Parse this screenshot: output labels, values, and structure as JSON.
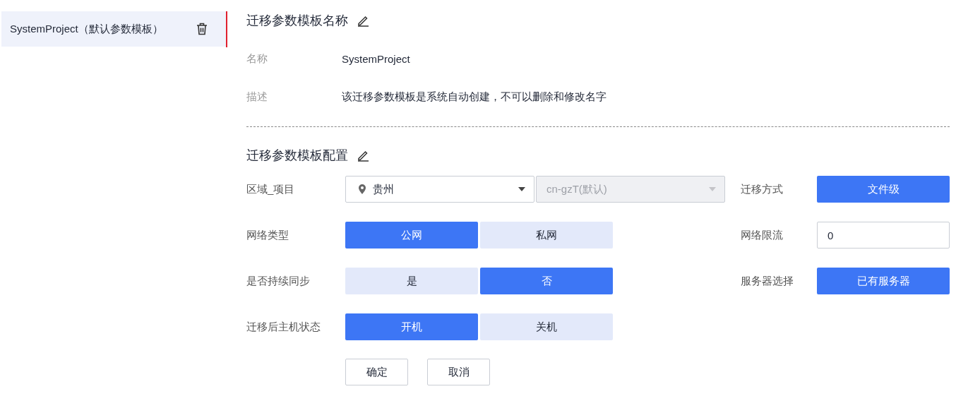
{
  "sidebar": {
    "items": [
      {
        "label": "SystemProject（默认参数模板）",
        "selected": true
      }
    ]
  },
  "name_section": {
    "title": "迁移参数模板名称",
    "fields": [
      {
        "label": "名称",
        "value": "SystemProject"
      },
      {
        "label": "描述",
        "value": "该迁移参数模板是系统自动创建，不可以删除和修改名字"
      }
    ]
  },
  "config_section": {
    "title": "迁移参数模板配置",
    "left_rows": [
      {
        "kind": "select",
        "label": "区域_项目",
        "region": "贵州",
        "project": "cn-gzT(默认)",
        "project_disabled": true
      },
      {
        "kind": "toggle",
        "label": "网络类型",
        "options": [
          {
            "label": "公网",
            "selected": true
          },
          {
            "label": "私网",
            "selected": false
          }
        ]
      },
      {
        "kind": "toggle",
        "label": "是否持续同步",
        "options": [
          {
            "label": "是",
            "selected": false
          },
          {
            "label": "否",
            "selected": true
          }
        ]
      },
      {
        "kind": "toggle",
        "label": "迁移后主机状态",
        "options": [
          {
            "label": "开机",
            "selected": true
          },
          {
            "label": "关机",
            "selected": false
          }
        ]
      }
    ],
    "right_rows": [
      {
        "kind": "toggle",
        "label": "迁移方式",
        "options": [
          {
            "label": "文件级",
            "selected": true
          }
        ]
      },
      {
        "kind": "input",
        "label": "网络限流",
        "value": "0"
      },
      {
        "kind": "toggle",
        "label": "服务器选择",
        "options": [
          {
            "label": "已有服务器",
            "selected": true
          }
        ]
      }
    ]
  },
  "actions": [
    "确定",
    "取消"
  ]
}
